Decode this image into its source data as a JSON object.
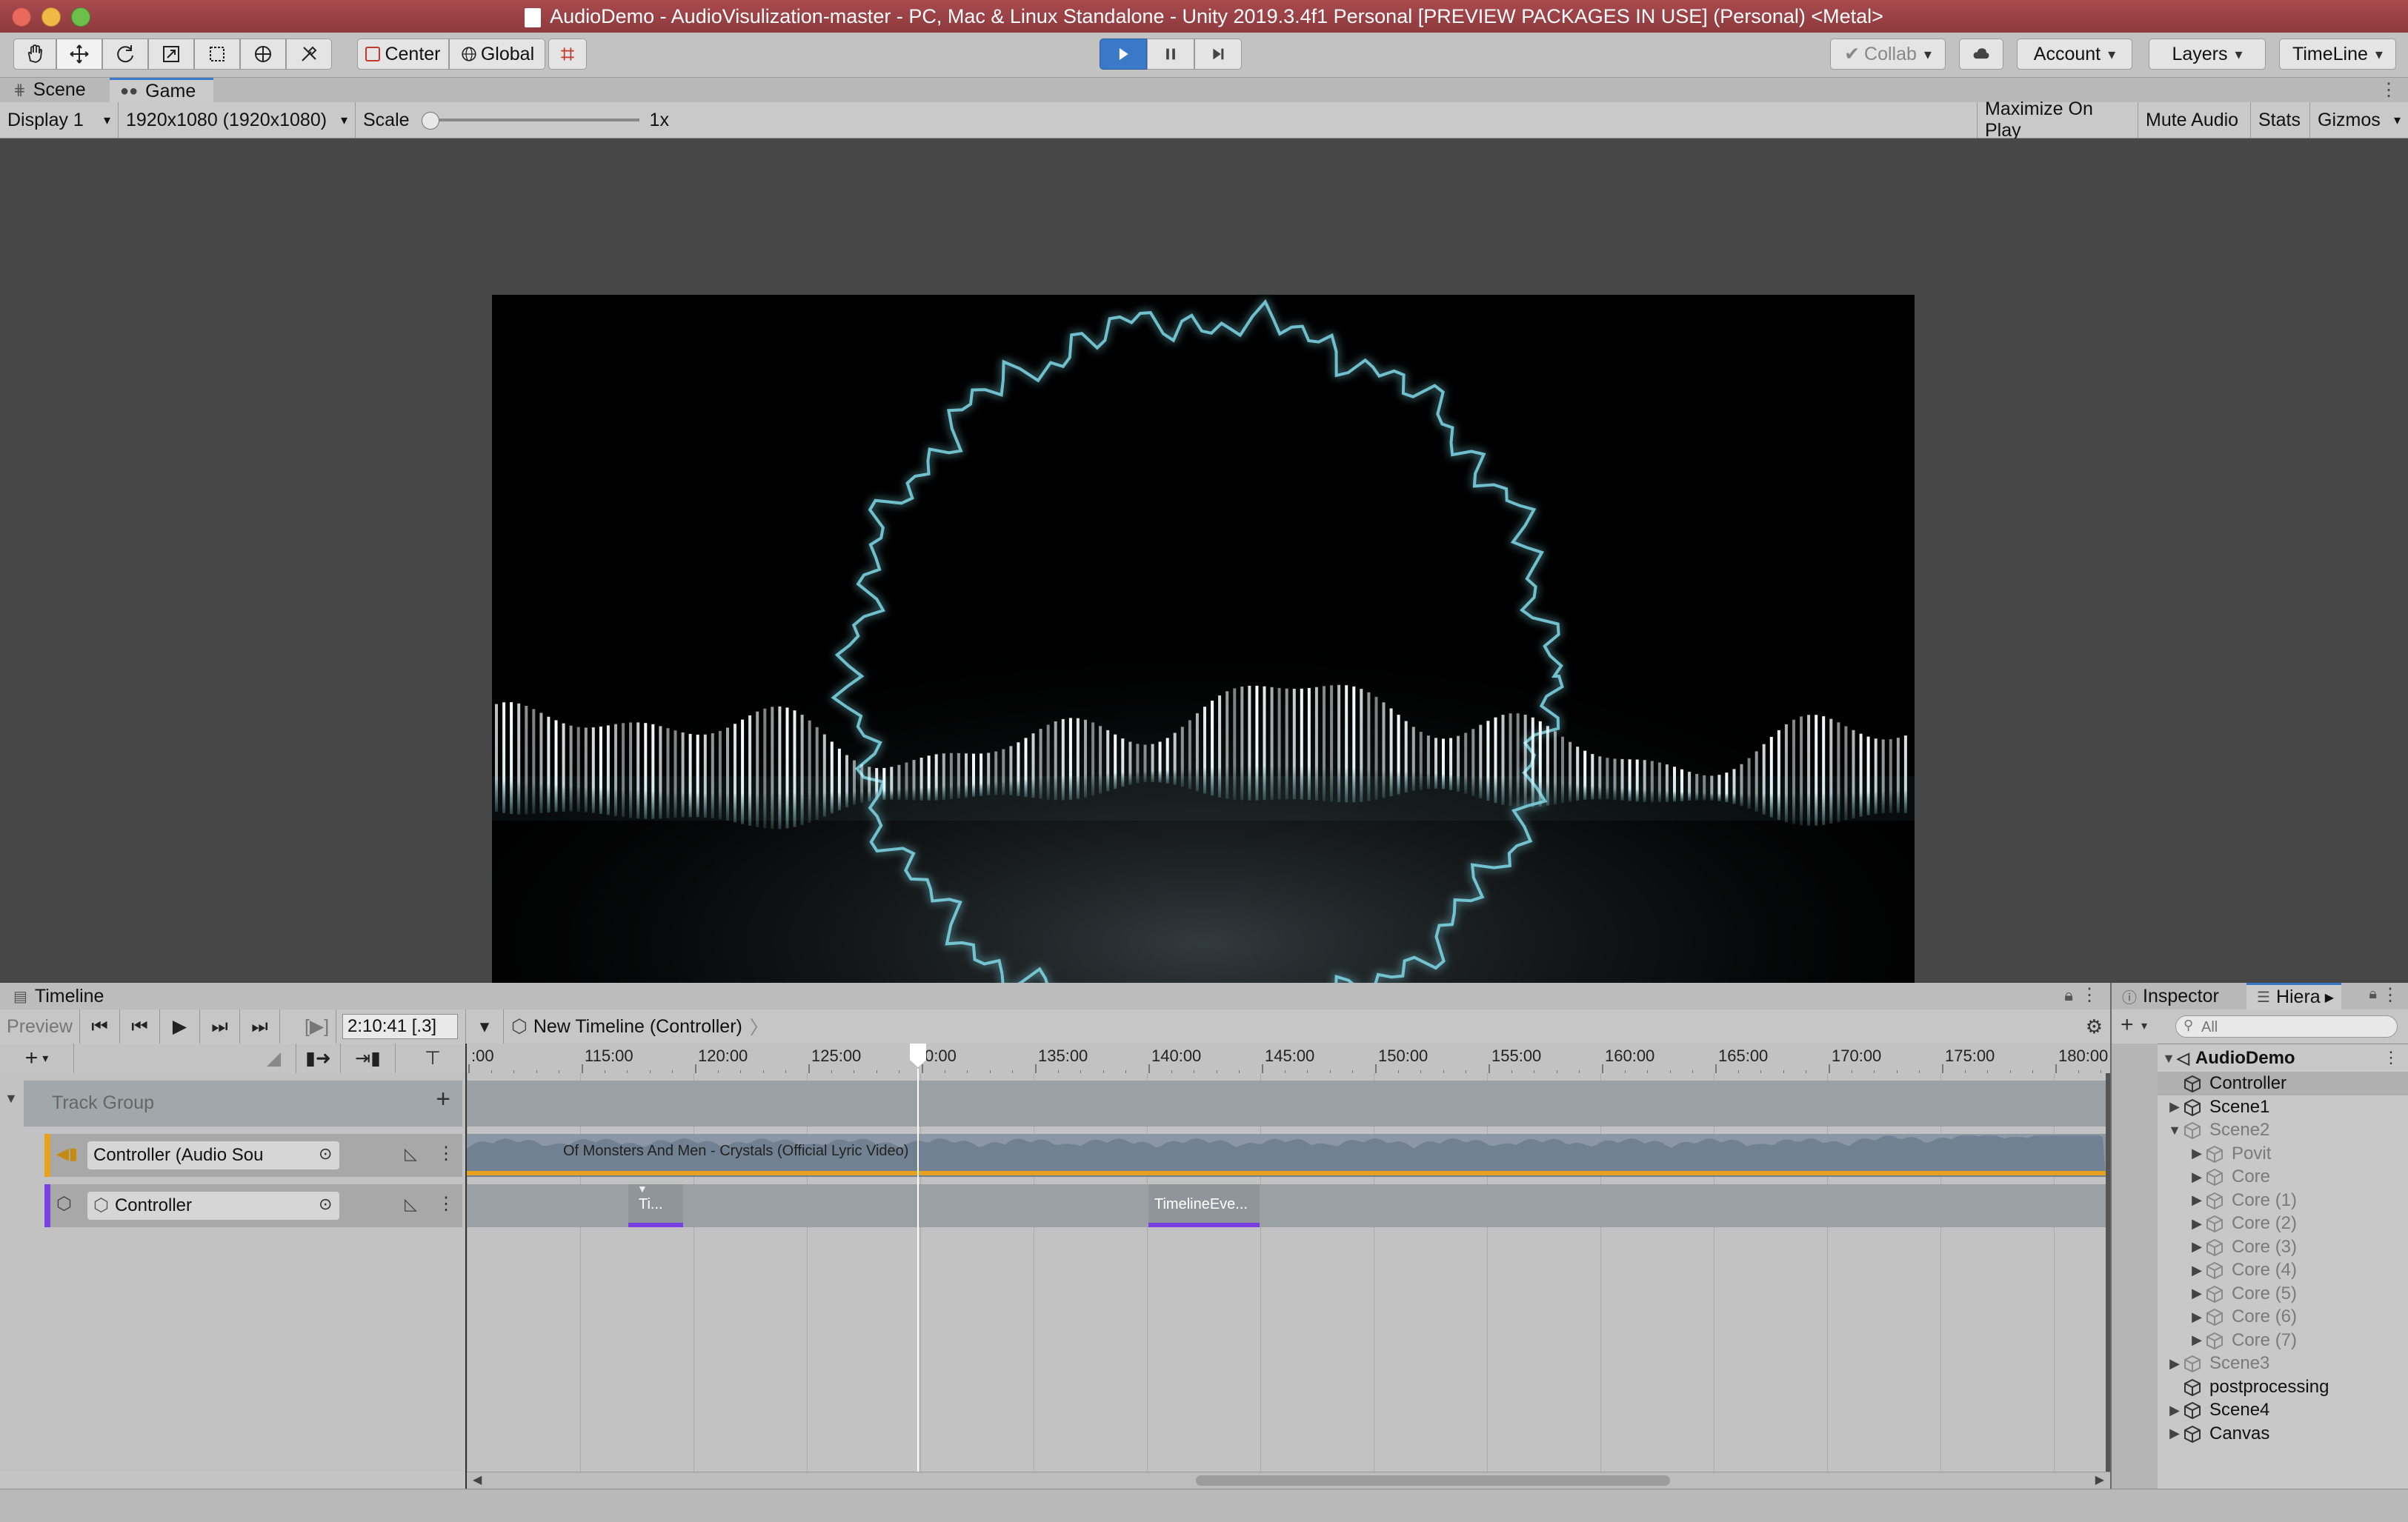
{
  "window": {
    "title": "AudioDemo - AudioVisulization-master - PC, Mac & Linux Standalone - Unity 2019.3.4f1 Personal [PREVIEW PACKAGES IN USE] (Personal) <Metal>"
  },
  "toolbar": {
    "pivot_label": "Center",
    "space_label": "Global",
    "collab_label": "Collab",
    "account_label": "Account",
    "layers_label": "Layers",
    "layout_label": "TimeLine",
    "tools": [
      "hand-tool",
      "move-tool",
      "rotate-tool",
      "scale-tool",
      "rect-tool",
      "transform-tool",
      "custom-tool"
    ]
  },
  "tabs": {
    "scene": "Scene",
    "game": "Game"
  },
  "game_bar": {
    "display": "Display 1",
    "resolution": "1920x1080 (1920x1080)",
    "scale_label": "Scale",
    "scale_value": "1x",
    "maximize": "Maximize On Play",
    "mute": "Mute Audio",
    "stats": "Stats",
    "gizmos": "Gizmos"
  },
  "timeline": {
    "tab_label": "Timeline",
    "preview_label": "Preview",
    "time_value": "2:10:41 [.3]",
    "asset_label": "New Timeline (Controller)",
    "ruler_labels": [
      ":00",
      "115:00",
      "120:00",
      "125:00",
      "0:00",
      "135:00",
      "140:00",
      "145:00",
      "150:00",
      "155:00",
      "160:00",
      "165:00",
      "170:00",
      "175:00",
      "180:00"
    ],
    "track_group_label": "Track Group",
    "audio_track_label": "Controller (Audio Sou",
    "controller_track_label": "Controller",
    "audio_clip_label": "Of Monsters And Men - Crystals (Official Lyric Video)",
    "signal_clip_1": "Ti...",
    "signal_clip_2": "TimelineEve..."
  },
  "inspector": {
    "tab_inspector": "Inspector",
    "tab_hierarchy": "Hiera",
    "search_placeholder": "All"
  },
  "hierarchy": {
    "root": "AudioDemo",
    "items": [
      {
        "label": "Controller",
        "depth": 1,
        "expand": "none",
        "dimmed": false,
        "selected": true
      },
      {
        "label": "Scene1",
        "depth": 1,
        "expand": "collapsed",
        "dimmed": false,
        "selected": false
      },
      {
        "label": "Scene2",
        "depth": 1,
        "expand": "expanded",
        "dimmed": true,
        "selected": false
      },
      {
        "label": "Povit",
        "depth": 2,
        "expand": "collapsed",
        "dimmed": true,
        "selected": false
      },
      {
        "label": "Core",
        "depth": 2,
        "expand": "collapsed",
        "dimmed": true,
        "selected": false
      },
      {
        "label": "Core (1)",
        "depth": 2,
        "expand": "collapsed",
        "dimmed": true,
        "selected": false
      },
      {
        "label": "Core (2)",
        "depth": 2,
        "expand": "collapsed",
        "dimmed": true,
        "selected": false
      },
      {
        "label": "Core (3)",
        "depth": 2,
        "expand": "collapsed",
        "dimmed": true,
        "selected": false
      },
      {
        "label": "Core (4)",
        "depth": 2,
        "expand": "collapsed",
        "dimmed": true,
        "selected": false
      },
      {
        "label": "Core (5)",
        "depth": 2,
        "expand": "collapsed",
        "dimmed": true,
        "selected": false
      },
      {
        "label": "Core (6)",
        "depth": 2,
        "expand": "collapsed",
        "dimmed": true,
        "selected": false
      },
      {
        "label": "Core (7)",
        "depth": 2,
        "expand": "collapsed",
        "dimmed": true,
        "selected": false
      },
      {
        "label": "Scene3",
        "depth": 1,
        "expand": "collapsed",
        "dimmed": true,
        "selected": false
      },
      {
        "label": "postprocessing",
        "depth": 1,
        "expand": "none",
        "dimmed": false,
        "selected": false
      },
      {
        "label": "Scene4",
        "depth": 1,
        "expand": "collapsed",
        "dimmed": false,
        "selected": false
      },
      {
        "label": "Canvas",
        "depth": 1,
        "expand": "collapsed",
        "dimmed": false,
        "selected": false
      }
    ]
  },
  "colors": {
    "title_bar": "#9a4145",
    "accent_blue": "#3a78c8",
    "audio_track": "#e6a21e",
    "signal_track": "#7a3fe0",
    "visualizer_glow": "#7fd8e8"
  }
}
